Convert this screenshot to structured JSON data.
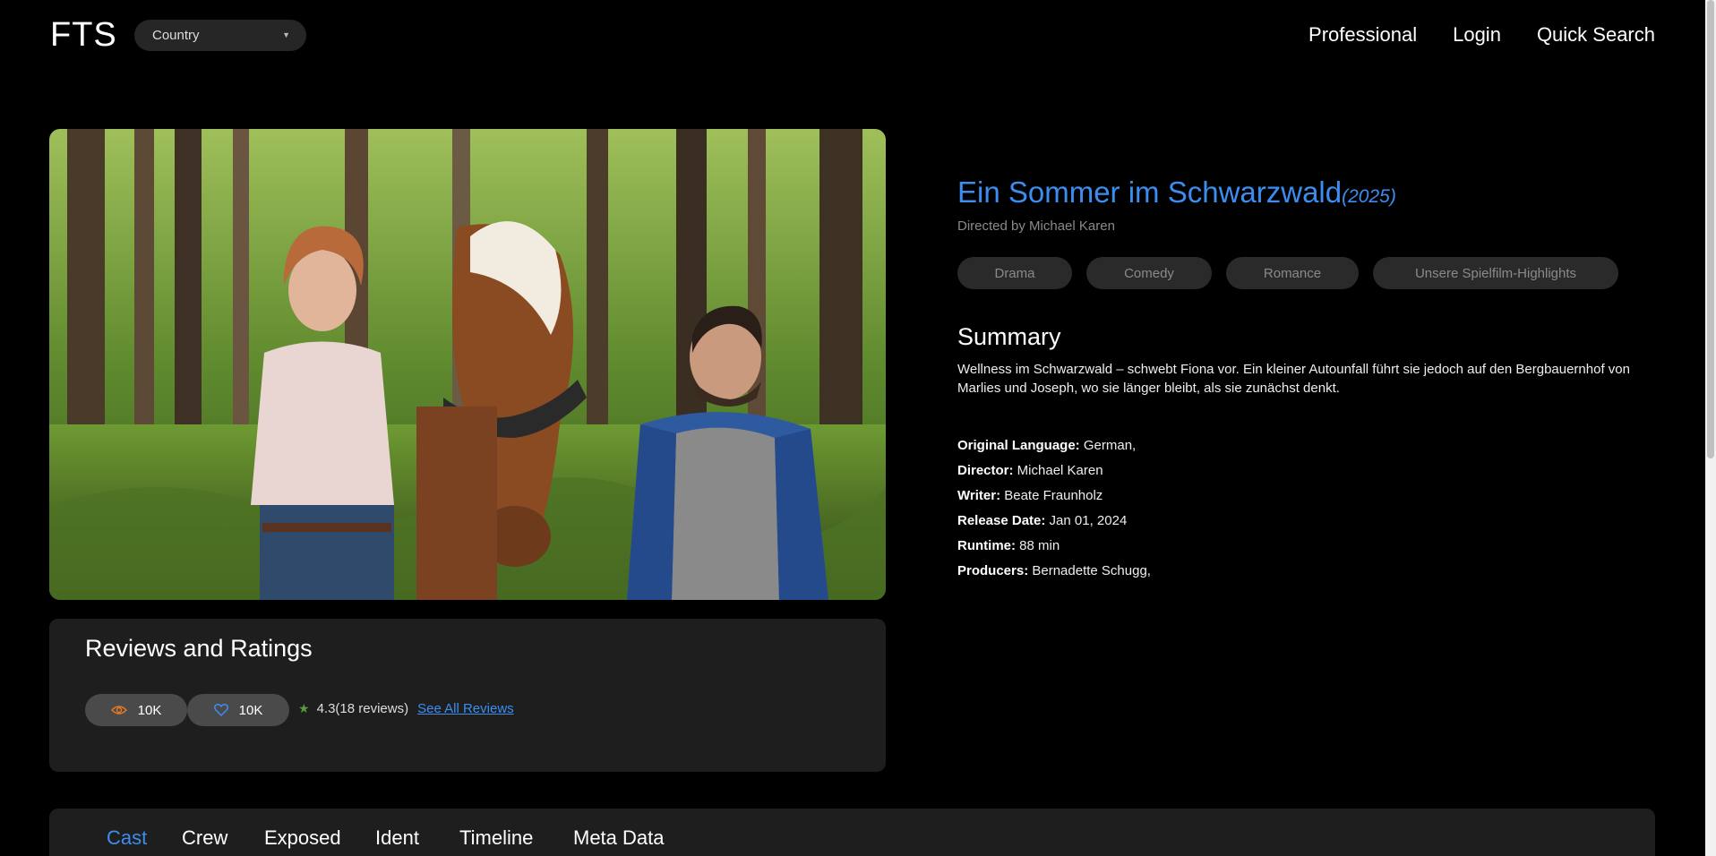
{
  "header": {
    "logo": "FTS",
    "country_select": {
      "value": "Country"
    },
    "nav": [
      "Professional",
      "Login",
      "Quick Search"
    ]
  },
  "hero": {
    "icon": "film-still-image"
  },
  "reviews": {
    "heading": "Reviews and Ratings",
    "views": "10K",
    "likes": "10K",
    "rating": "4.3(18 reviews)",
    "see_all": "See All Reviews",
    "colors": {
      "view_icon": "#e07a2b",
      "like_icon": "#3b8ef0",
      "star": "#5a9e3a"
    }
  },
  "film": {
    "title": "Ein Sommer im Schwarzwald",
    "year": "(2025)",
    "directed_by": "Directed by Michael Karen",
    "genres": [
      "Drama",
      "Comedy",
      "Romance",
      "Unsere Spielfilm-Highlights"
    ],
    "summary_heading": "Summary",
    "summary": "Wellness im Schwarzwald – schwebt Fiona vor. Ein kleiner Autounfall führt sie jedoch auf den Bergbauernhof von Marlies und Joseph, wo sie länger bleibt, als sie zunächst denkt.",
    "facts": [
      {
        "label": "Original Language:",
        "value": " German,"
      },
      {
        "label": "Director:",
        "value": " Michael Karen"
      },
      {
        "label": "Writer:",
        "value": " Beate Fraunholz"
      },
      {
        "label": "Release Date:",
        "value": " Jan 01, 2024"
      },
      {
        "label": "Runtime:",
        "value": " 88 min"
      },
      {
        "label": "Producers:",
        "value": " Bernadette Schugg,"
      }
    ]
  },
  "tabs": [
    "Cast",
    "Crew",
    "Exposed",
    "Ident",
    "Timeline",
    "Meta Data"
  ],
  "active_tab": "Cast",
  "colors": {
    "accent": "#3b8ef0",
    "background": "#000000",
    "panel": "#1e1e1e"
  }
}
